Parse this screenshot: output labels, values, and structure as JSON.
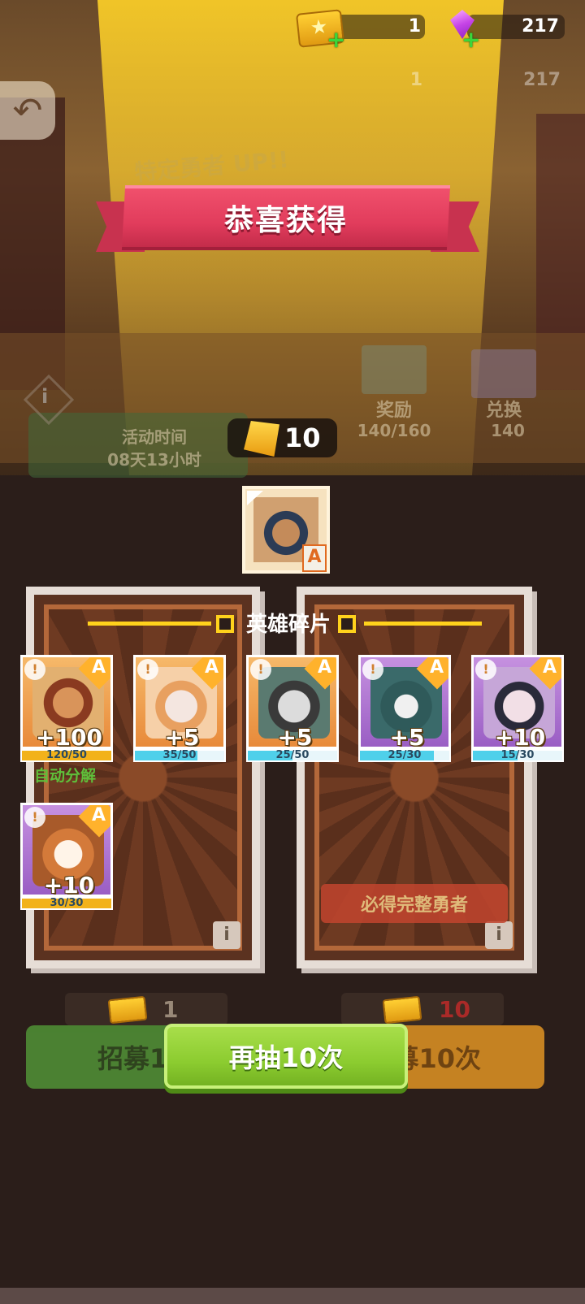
{
  "currency": {
    "tickets": "1",
    "gems": "217",
    "ticket_icon": "gold-ticket-icon",
    "gem_icon": "purple-gem-icon",
    "add_icon": "green-plus-icon"
  },
  "background": {
    "ghost_tickets": "1",
    "ghost_gems": "217",
    "banner_text": "特定勇者 UP!!",
    "reward_label": "奖励",
    "reward_progress": "140/160",
    "exchange_label": "兑换",
    "exchange_cost": "140",
    "activity_label": "活动时间",
    "activity_time": "08天13小时",
    "guarantee_text": "必得完整勇者"
  },
  "dialog": {
    "title": "恭喜获得",
    "coin_count": "10",
    "fragments_header": "英雄碎片",
    "auto_decompose": "自动分解"
  },
  "top_hero": {
    "grade": "A"
  },
  "fragments": [
    {
      "amount": "+100",
      "progress": "120/50",
      "fill": 1.0,
      "frame": "orange",
      "grade": "A"
    },
    {
      "amount": "+5",
      "progress": "35/50",
      "fill": 0.7,
      "frame": "orange",
      "grade": "A"
    },
    {
      "amount": "+5",
      "progress": "25/50",
      "fill": 0.5,
      "frame": "orange",
      "grade": "A"
    },
    {
      "amount": "+5",
      "progress": "25/30",
      "fill": 0.83,
      "frame": "purple",
      "grade": "A"
    },
    {
      "amount": "+10",
      "progress": "15/30",
      "fill": 0.5,
      "frame": "purple",
      "grade": "A"
    },
    {
      "amount": "+10",
      "progress": "30/30",
      "fill": 1.0,
      "frame": "purple",
      "grade": "A"
    }
  ],
  "buttons": {
    "single_cost": "1",
    "ten_cost": "10",
    "single_label": "招募1",
    "ten_label": "募10次",
    "redraw_label": "再抽10次"
  },
  "colors": {
    "accent_yellow": "#ffd21c",
    "ribbon_red": "#e13c5c",
    "button_green": "#8ccc30",
    "progress_cyan": "#4fd0ea",
    "progress_full": "#f2b21a",
    "cost_red": "#d02a2a"
  }
}
